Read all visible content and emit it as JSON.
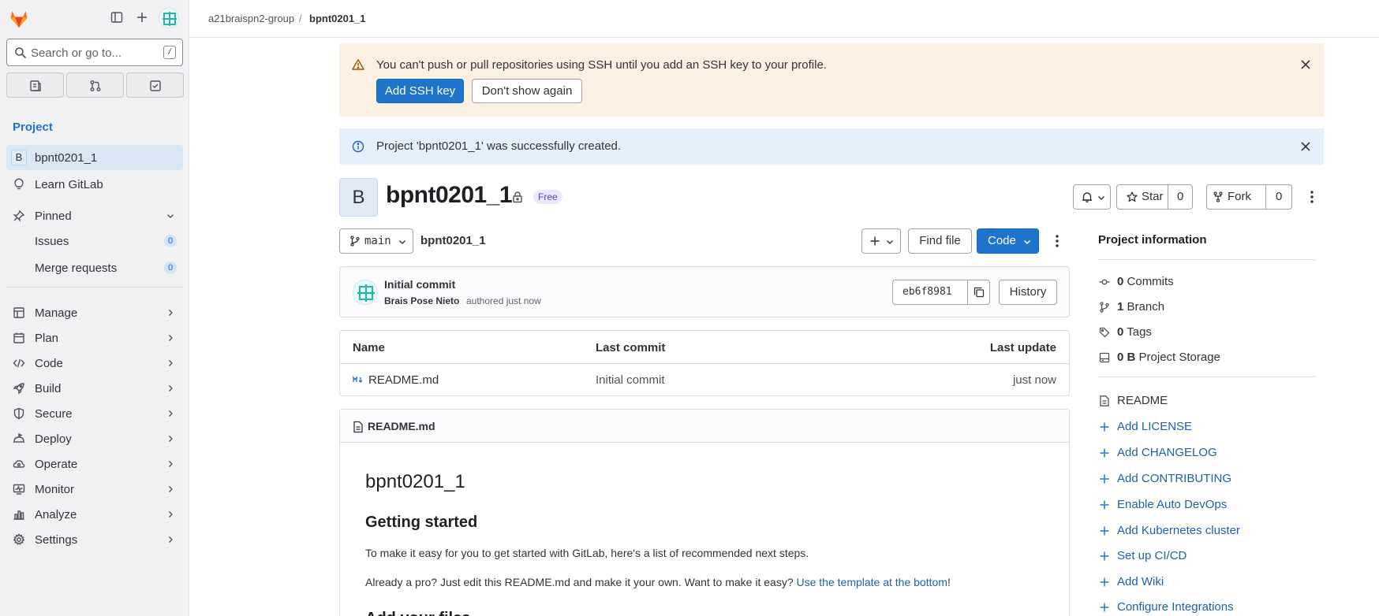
{
  "sidebar": {
    "search_placeholder": "Search or go to...",
    "search_shortcut": "/",
    "section_title": "Project",
    "project_badge": "B",
    "project_name": "bpnt0201_1",
    "learn": "Learn GitLab",
    "pinned": "Pinned",
    "pinned_items": [
      {
        "label": "Issues",
        "count": "0"
      },
      {
        "label": "Merge requests",
        "count": "0"
      }
    ],
    "menu": [
      "Manage",
      "Plan",
      "Code",
      "Build",
      "Secure",
      "Deploy",
      "Operate",
      "Monitor",
      "Analyze",
      "Settings"
    ]
  },
  "breadcrumb": {
    "group": "a21braispn2-group",
    "separator": "/",
    "project": "bpnt0201_1"
  },
  "alerts": {
    "ssh_text": "You can't push or pull repositories using SSH until you add an SSH key to your profile.",
    "ssh_add": "Add SSH key",
    "ssh_dismiss": "Don't show again",
    "created_text": "Project 'bpnt0201_1' was successfully created."
  },
  "project": {
    "avatar_letter": "B",
    "title": "bpnt0201_1",
    "tier": "Free",
    "star_label": "Star",
    "star_count": "0",
    "fork_label": "Fork",
    "fork_count": "0"
  },
  "repo": {
    "branch": "main",
    "path": "bpnt0201_1",
    "find_file": "Find file",
    "code": "Code"
  },
  "commit": {
    "message": "Initial commit",
    "author": "Brais Pose Nieto",
    "meta": "authored just now",
    "sha": "eb6f8981",
    "history": "History"
  },
  "files": {
    "headers": {
      "name": "Name",
      "last_commit": "Last commit",
      "last_update": "Last update"
    },
    "rows": [
      {
        "name": "README.md",
        "commit": "Initial commit",
        "updated": "just now"
      }
    ]
  },
  "readme": {
    "filename": "README.md",
    "h1": "bpnt0201_1",
    "h2": "Getting started",
    "p1": "To make it easy for you to get started with GitLab, here's a list of recommended next steps.",
    "p2_before": "Already a pro? Just edit this README.md and make it your own. Want to make it easy? ",
    "p2_link": "Use the template at the bottom",
    "p2_after": "!",
    "h2b": "Add your files"
  },
  "project_info": {
    "title": "Project information",
    "stats": [
      {
        "value": "0",
        "label": "Commits"
      },
      {
        "value": "1",
        "label": "Branch"
      },
      {
        "value": "0",
        "label": "Tags"
      },
      {
        "value": "0 B",
        "label": "Project Storage"
      }
    ],
    "readme": "README",
    "actions": [
      "Add LICENSE",
      "Add CHANGELOG",
      "Add CONTRIBUTING",
      "Enable Auto DevOps",
      "Add Kubernetes cluster",
      "Set up CI/CD",
      "Add Wiki",
      "Configure Integrations"
    ]
  },
  "colors": {
    "accent": "#1f75cb",
    "sidebar_bg": "#f1f0f3",
    "warning_bg": "#fcf0e3",
    "info_bg": "#e4f0fb"
  }
}
